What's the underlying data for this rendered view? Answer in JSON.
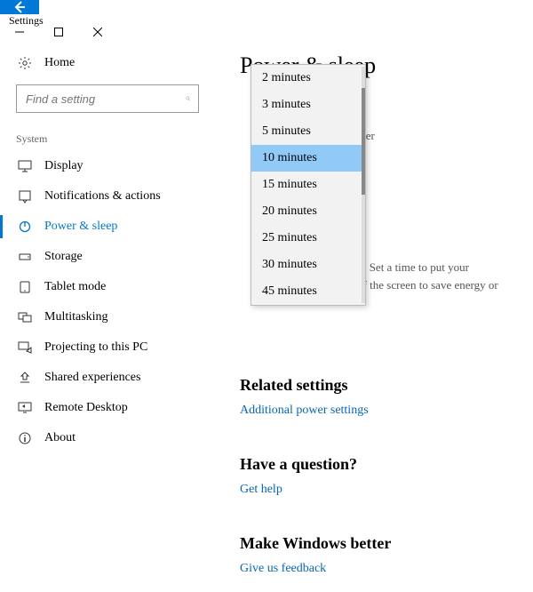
{
  "titlebar": {
    "title": "Settings"
  },
  "sidebar": {
    "home_label": "Home",
    "search_placeholder": "Find a setting",
    "section_label": "System",
    "items": [
      {
        "label": "Display"
      },
      {
        "label": "Notifications & actions"
      },
      {
        "label": "Power & sleep"
      },
      {
        "label": "Storage"
      },
      {
        "label": "Tablet mode"
      },
      {
        "label": "Multitasking"
      },
      {
        "label": "Projecting to this PC"
      },
      {
        "label": "Shared experiences"
      },
      {
        "label": "Remote Desktop"
      },
      {
        "label": "About"
      }
    ]
  },
  "content": {
    "page_title": "Power & sleep",
    "partial_after": "after",
    "partial_q_line1": "C? Set a time to put your",
    "partial_q_line2": "off the screen to save energy or",
    "related_heading": "Related settings",
    "related_link": "Additional power settings",
    "question_heading": "Have a question?",
    "question_link": "Get help",
    "feedback_heading": "Make Windows better",
    "feedback_link": "Give us feedback"
  },
  "dropdown": {
    "options": [
      "2 minutes",
      "3 minutes",
      "5 minutes",
      "10 minutes",
      "15 minutes",
      "20 minutes",
      "25 minutes",
      "30 minutes",
      "45 minutes"
    ],
    "selected_index": 3
  }
}
